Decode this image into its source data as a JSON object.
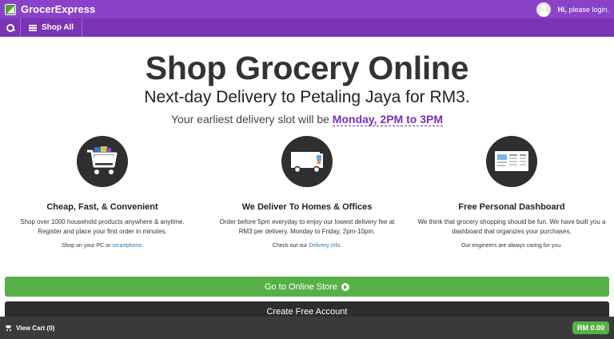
{
  "header": {
    "brand": "GrocerExpress",
    "user_greeting": "Hi,",
    "login_text": "please login."
  },
  "nav": {
    "shop_all": "Shop All",
    "icons": [
      "search-icon",
      "menu-icon"
    ]
  },
  "hero": {
    "title": "Shop Grocery Online",
    "subtitle": "Next-day Delivery to Petaling Jaya for RM3.",
    "slot_prefix": "Your earliest delivery slot will be",
    "slot_value": "Monday, 2PM to 3PM"
  },
  "features": [
    {
      "icon": "shopping-cart-icon",
      "title": "Cheap, Fast, & Convenient",
      "desc": "Shop over 1000 household products anywhere & anytime. Register and place your first order in minutes.",
      "note_prefix": "Shop on your PC or",
      "note_link": "smartphone",
      "note_suffix": "."
    },
    {
      "icon": "delivery-truck-icon",
      "title": "We Deliver To Homes & Offices",
      "desc": "Order before 5pm everyday to enjoy our lowest delivery fee at RM3 per delivery. Monday to Friday, 2pm-10pm.",
      "note_prefix": "Check out our",
      "note_link": "Delivery Info",
      "note_suffix": "."
    },
    {
      "icon": "dashboard-icon",
      "title": "Free Personal Dashboard",
      "desc": "We think that grocery shopping should be fun. We have built you a dashboard that organizes your purchases.",
      "note_prefix": "Our engineers are always caring for you.",
      "note_link": "",
      "note_suffix": ""
    }
  ],
  "actions": {
    "store_button": "Go to Online Store",
    "create_button": "Create Free Account"
  },
  "cart": {
    "label": "View Cart (0)",
    "total": "RM 0.00"
  },
  "colors": {
    "header_purple": "#8a42c9",
    "nav_purple": "#7b34b4",
    "accent_green": "#57b047",
    "slot_purple": "#7a2ec0",
    "link_blue": "#2b7bb9",
    "dark": "#2f2f2f"
  }
}
